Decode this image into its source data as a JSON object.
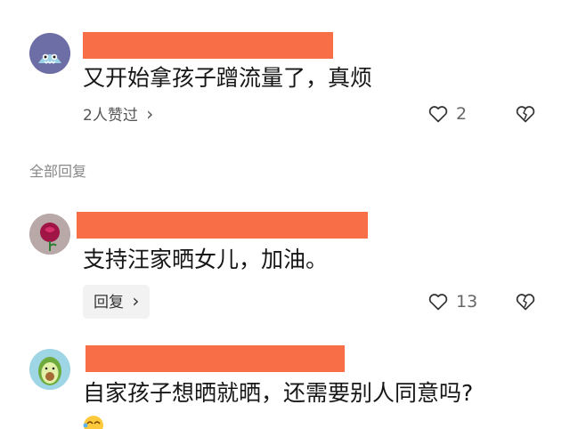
{
  "comments": [
    {
      "text": "又开始拿孩子蹭流量了，真烦",
      "likes_summary": "2人赞过",
      "like_count": "2"
    },
    {
      "text": "支持汪家晒女儿，加油。",
      "reply_label": "回复",
      "like_count": "13"
    },
    {
      "text": "自家孩子想晒就晒，还需要别人同意吗?"
    }
  ],
  "section_title": "全部回复",
  "chevron": "›",
  "colors": {
    "name_redaction": "#f86f47",
    "avatar1_bg": "#6e6ea6",
    "avatar2_bg": "#b8a8a8",
    "avatar3_bg": "#9fd6e6"
  },
  "icons": [
    "monster-avatar-icon",
    "rose-avatar-icon",
    "avocado-avatar-icon",
    "heart-icon",
    "broken-heart-icon",
    "laughing-emoji-icon"
  ]
}
